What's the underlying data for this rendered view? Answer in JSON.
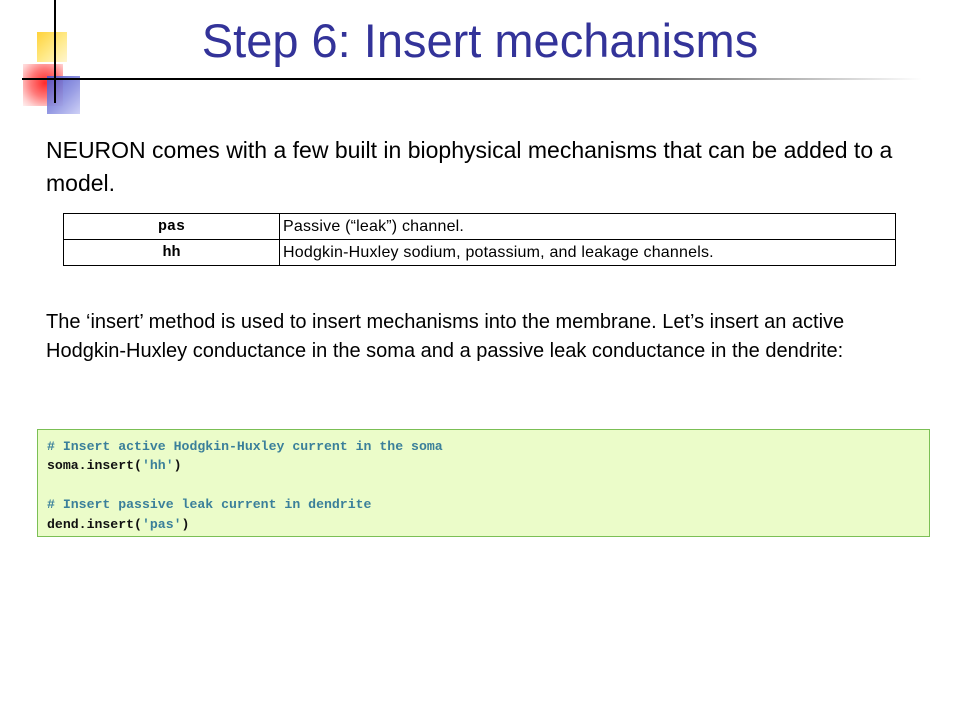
{
  "slide": {
    "title": "Step 6: Insert mechanisms",
    "intro": "NEURON comes with a few built in biophysical mechanisms that can be added to a model.",
    "mechanisms": [
      {
        "name": "pas",
        "description": "Passive (“leak”) channel."
      },
      {
        "name": "hh",
        "description": "Hodgkin-Huxley sodium, potassium, and leakage channels."
      }
    ],
    "explanation": "The ‘insert’ method is used to insert mechanisms into the membrane. Let’s insert an active Hodgkin-Huxley conductance in the soma and a passive leak conductance in the dendrite:",
    "code": {
      "comment1": "# Insert active Hodgkin-Huxley current in the soma",
      "line1_prefix": "soma.insert(",
      "line1_arg": "'hh'",
      "line1_suffix": ")",
      "comment2": "# Insert passive leak current in dendrite",
      "line2_prefix": "dend.insert(",
      "line2_arg": "'pas'",
      "line2_suffix": ")"
    }
  },
  "colors": {
    "title": "#333399",
    "code_background": "#ebfcc9",
    "code_border": "#7bbf55",
    "code_comment": "#3a7f9a"
  }
}
